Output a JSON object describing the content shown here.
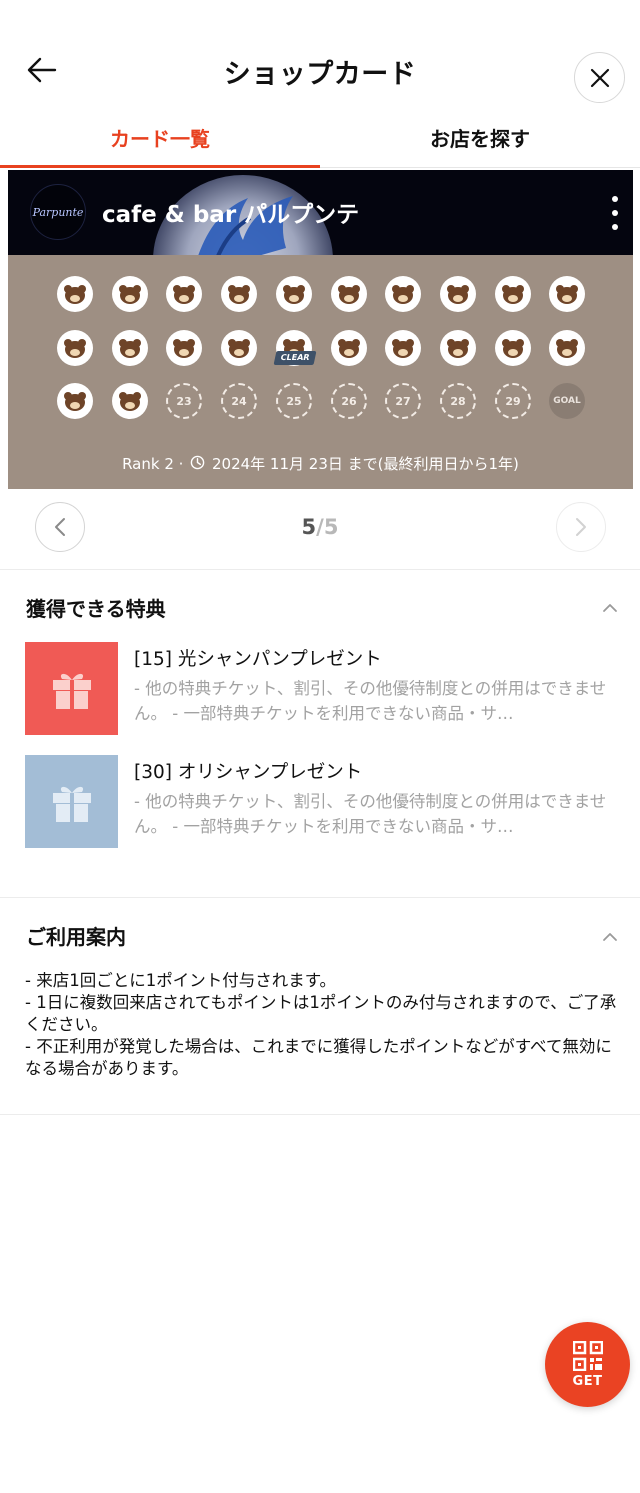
{
  "header": {
    "title": "ショップカード",
    "back_icon": "arrow-left-icon",
    "close_icon": "close-icon"
  },
  "tabs": [
    {
      "label": "カード一覧",
      "active": true
    },
    {
      "label": "お店を探す",
      "active": false
    }
  ],
  "card": {
    "shop_logo_text": "Parpunte",
    "shop_name": "cafe & bar パルプンテ",
    "menu_icon": "more-vertical-icon",
    "stamps_collected": 22,
    "stamps_total": 30,
    "clear_label": "CLEAR",
    "empty_numbers": [
      "23",
      "24",
      "25",
      "26",
      "27",
      "28",
      "29"
    ],
    "goal_label": "GOAL",
    "rank": "Rank 2 ·",
    "expiry": "2024年 11月 23日 まで(最終利用日から1年)"
  },
  "pager": {
    "current": "5",
    "total": "/5"
  },
  "benefits": {
    "title": "獲得できる特典",
    "items": [
      {
        "title": "[15] 光シャンパンプレゼント",
        "desc": "- 他の特典チケット、割引、その他優待制度との併用はできません。 - 一部特典チケットを利用できない商品・サ…",
        "color": "#f05a55"
      },
      {
        "title": "[30] オリシャンプレゼント",
        "desc": "- 他の特典チケット、割引、その他優待制度との併用はできません。 - 一部特典チケットを利用できない商品・サ…",
        "color": "#a3bdd6"
      }
    ]
  },
  "guide": {
    "title": "ご利用案内",
    "lines": [
      "- 来店1回ごとに1ポイント付与されます。",
      "- 1日に複数回来店されてもポイントは1ポイントのみ付与されますので、ご了承ください。",
      "- 不正利用が発覚した場合は、これまでに獲得したポイントなどがすべて無効になる場合があります。"
    ]
  },
  "get_button": {
    "label": "GET",
    "icon": "qr-code-icon"
  },
  "colors": {
    "accent": "#e8411f",
    "card_bg": "#9e8f83",
    "card_header": "#04050f"
  }
}
